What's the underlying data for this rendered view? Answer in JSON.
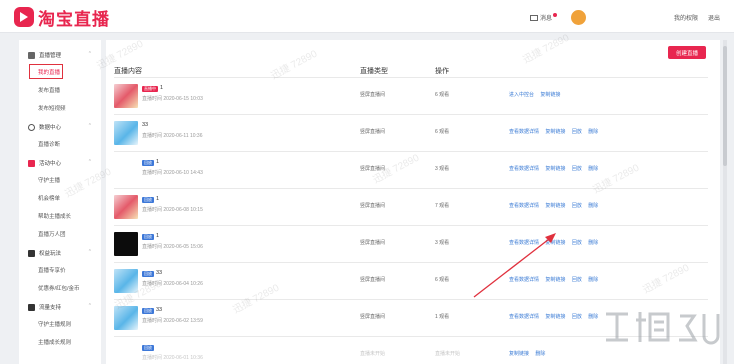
{
  "header": {
    "logo_text": "淘宝直播",
    "messages_label": "消息",
    "my_permissions": "我的权限",
    "logout": "退出"
  },
  "sidebar": {
    "groups": [
      {
        "label": "直播管理",
        "items": [
          "我的直播",
          "发布直播",
          "发布短视频"
        ]
      },
      {
        "label": "数据中心",
        "items": [
          "直播诊断"
        ]
      },
      {
        "label": "活动中心",
        "items": [
          "守护主播",
          "机会榜单",
          "帮助主播成长",
          "直播万人团"
        ]
      },
      {
        "label": "权益玩法",
        "items": [
          "直播专享价",
          "优惠券/红包/金币"
        ]
      },
      {
        "label": "流量支持",
        "items": [
          "守护主播规则",
          "主播成长规则"
        ]
      }
    ]
  },
  "main": {
    "create_button": "创建直播",
    "columns": {
      "content": "直播内容",
      "type": "直播类型",
      "ops": "操作"
    },
    "rows": [
      {
        "badge": "直播中",
        "title": "1",
        "time": "直播时间 2020-06-15 10:03",
        "type": "竖屏直播间",
        "views": "6 观看",
        "actions": [
          "进入中控台",
          "复制链接"
        ]
      },
      {
        "badge": "",
        "title": "33",
        "time": "直播时间 2020-06-11 10:36",
        "type": "竖屏直播间",
        "views": "6 观看",
        "actions": [
          "查看数据详情",
          "复制链接",
          "回放",
          "删除"
        ]
      },
      {
        "badge": "回放",
        "title": "1",
        "time": "直播时间 2020-06-10 14:43",
        "type": "竖屏直播间",
        "views": "3 观看",
        "actions": [
          "查看数据详情",
          "复制链接",
          "回放",
          "删除"
        ]
      },
      {
        "badge": "回放",
        "title": "1",
        "time": "直播时间 2020-06-08 10:15",
        "type": "竖屏直播间",
        "views": "7 观看",
        "actions": [
          "查看数据详情",
          "复制链接",
          "回放",
          "删除"
        ]
      },
      {
        "badge": "回放",
        "title": "1",
        "time": "直播时间 2020-06-05 15:06",
        "type": "竖屏直播间",
        "views": "3 观看",
        "actions": [
          "查看数据详情",
          "复制链接",
          "回放",
          "删除"
        ]
      },
      {
        "badge": "回放",
        "title": "33",
        "time": "直播时间 2020-06-04 10:26",
        "type": "竖屏直播间",
        "views": "6 观看",
        "actions": [
          "查看数据详情",
          "复制链接",
          "回放",
          "删除"
        ]
      },
      {
        "badge": "回放",
        "title": "33",
        "time": "直播时间 2020-06-02 13:59",
        "type": "竖屏直播间",
        "views": "1 观看",
        "actions": [
          "查看数据详情",
          "复制链接",
          "回放",
          "删除"
        ]
      },
      {
        "badge": "回放",
        "title": "",
        "time": "直播时间 2020-06-01 10:36",
        "type": "直播未开始",
        "views": "直播未开始",
        "actions": [
          "复制链接",
          "删除"
        ]
      }
    ]
  },
  "watermarks": [
    "迅捷 72890",
    "迅捷 72890",
    "迅捷 72890",
    "迅捷 72890",
    "迅捷 72890",
    "迅捷 72890",
    "迅捷 72890",
    "迅捷 72890",
    "迅捷 72890"
  ],
  "colors": {
    "accent": "#e8264f",
    "link": "#3a7bd5",
    "highlight_box": "#e0313e"
  }
}
